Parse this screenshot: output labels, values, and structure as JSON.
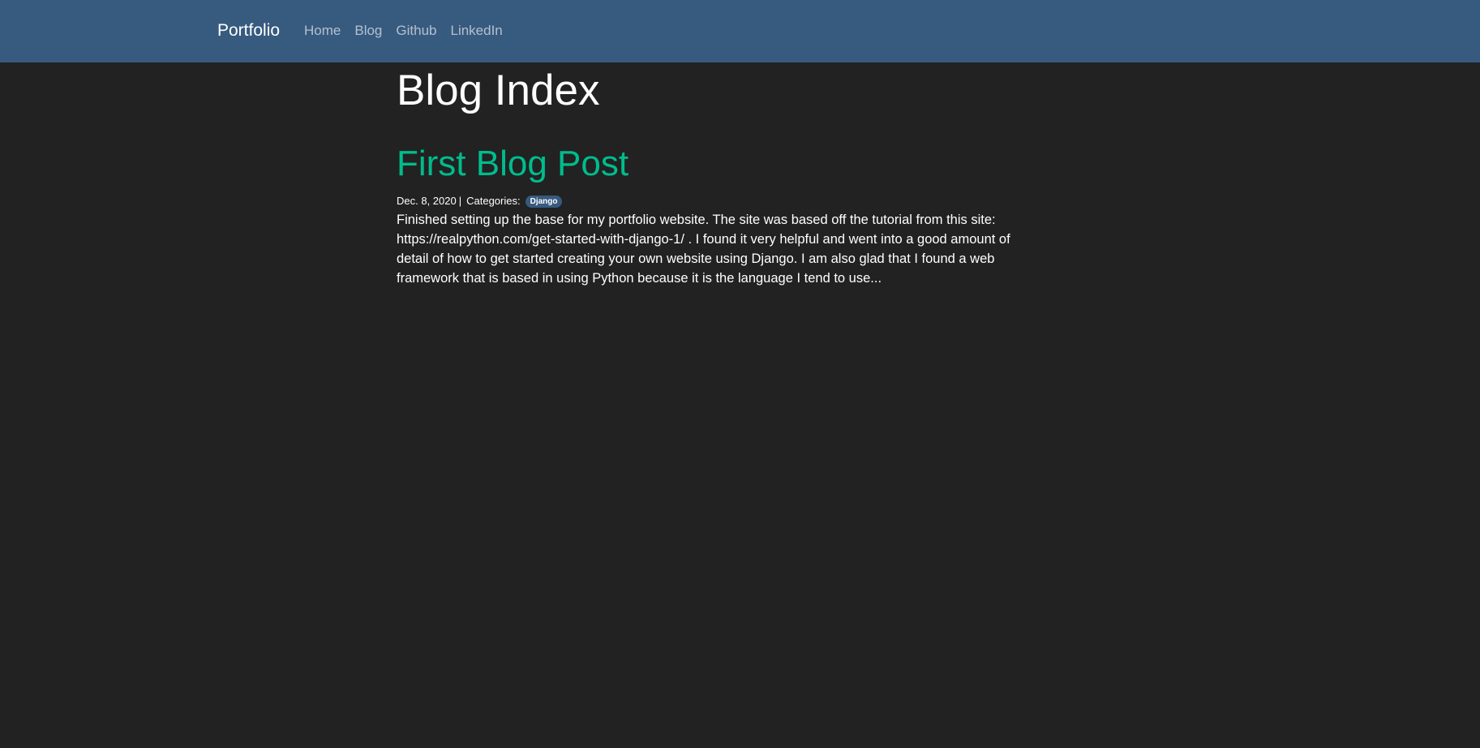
{
  "navbar": {
    "brand": "Portfolio",
    "links": [
      {
        "label": "Home"
      },
      {
        "label": "Blog"
      },
      {
        "label": "Github"
      },
      {
        "label": "LinkedIn"
      }
    ]
  },
  "main": {
    "title": "Blog Index",
    "posts": [
      {
        "title": "First Blog Post",
        "date": "Dec. 8, 2020",
        "separator": "|",
        "categories_label": "Categories:",
        "categories": [
          "Django"
        ],
        "excerpt": "Finished setting up the base for my portfolio website. The site was based off the tutorial from this site: https://realpython.com/get-started-with-django-1/ . I found it very helpful and went into a good amount of detail of how to get started creating your own website using Django. I am also glad that I found a web framework that is based in using Python because it is the language I tend to use..."
      }
    ]
  },
  "colors": {
    "background": "#222222",
    "navbar": "#375a7f",
    "post_title": "#00bc8c",
    "badge": "#375a7f"
  }
}
